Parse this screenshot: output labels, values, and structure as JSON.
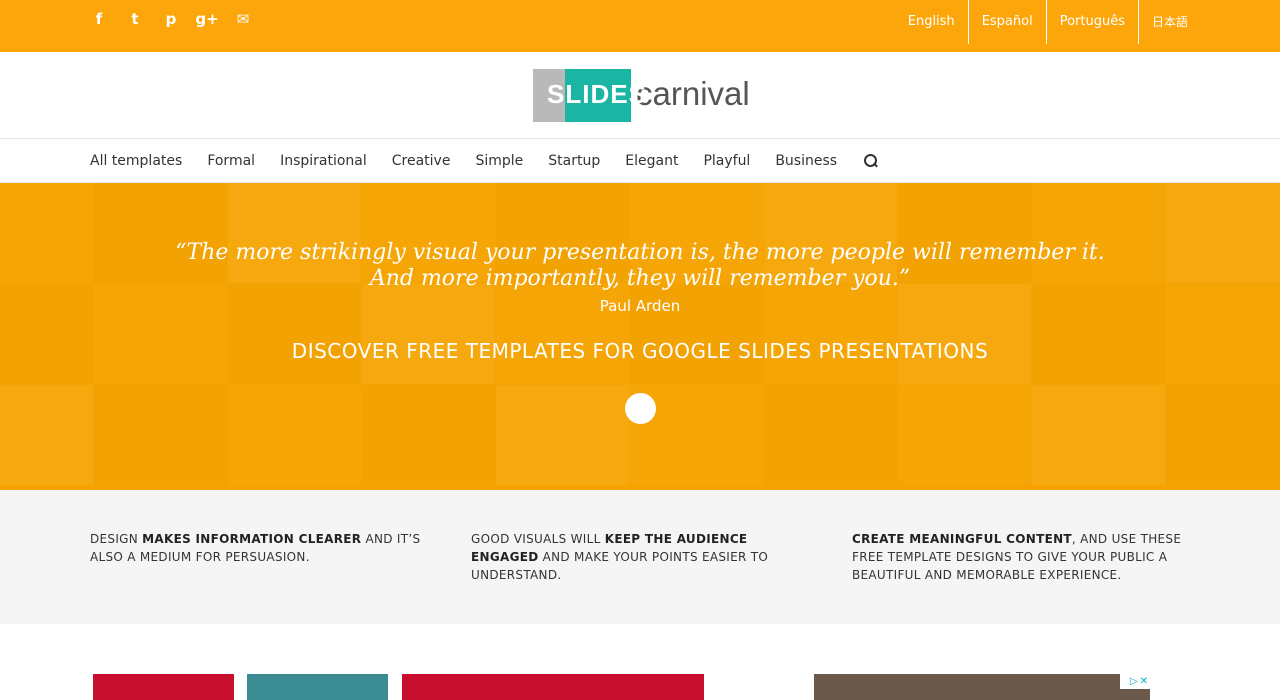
{
  "topbar": {
    "social_icons": [
      "facebook-icon",
      "twitter-icon",
      "pinterest-icon",
      "google-plus-icon",
      "email-icon"
    ],
    "social_glyphs": [
      "f",
      "t",
      "p",
      "g+",
      "✉"
    ],
    "languages": [
      "English",
      "Español",
      "Português",
      "日本語"
    ]
  },
  "header": {
    "logo_text": "SLIDES",
    "logo_word": "carnival"
  },
  "nav": {
    "items": [
      "All templates",
      "Formal",
      "Inspirational",
      "Creative",
      "Simple",
      "Startup",
      "Elegant",
      "Playful",
      "Business"
    ]
  },
  "hero": {
    "quote_line1": "“The more strikingly visual your presentation is, the more people will remember it.",
    "quote_line2": "And more importantly, they will remember you.”",
    "author": "Paul Arden",
    "cta": "DISCOVER FREE TEMPLATES FOR GOOGLE SLIDES PRESENTATIONS"
  },
  "features": [
    {
      "pre": "DESIGN ",
      "bold": "MAKES INFORMATION CLEARER",
      "post": " AND IT’S ALSO A MEDIUM FOR PERSUASION."
    },
    {
      "pre": "GOOD VISUALS WILL ",
      "bold": "KEEP THE AUDIENCE ENGAGED",
      "post": " AND MAKE YOUR POINTS EASIER TO UNDERSTAND."
    },
    {
      "pre": "",
      "bold": "CREATE MEANINGFUL CONTENT",
      "post": ", AND USE THESE FREE TEMPLATE DESIGNS TO GIVE YOUR PUBLIC A BEAUTIFUL AND MEMORABLE EXPERIENCE."
    }
  ],
  "colors": {
    "brand_orange": "#fca60b",
    "teal": "#1bb5a3",
    "thumb_red": "#c8102e",
    "thumb_teal": "#3a8c92"
  }
}
